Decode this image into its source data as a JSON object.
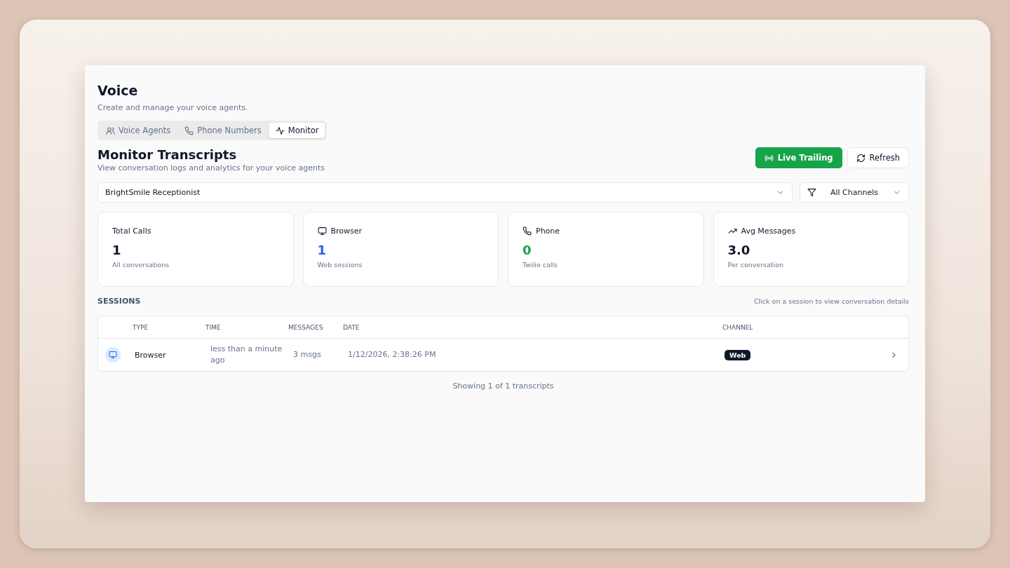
{
  "page": {
    "title": "Voice",
    "subtitle": "Create and manage your voice agents."
  },
  "tabs": [
    {
      "label": "Voice Agents",
      "kind": "agents",
      "selected": false
    },
    {
      "label": "Phone Numbers",
      "kind": "phone",
      "selected": false
    },
    {
      "label": "Monitor",
      "kind": "monitor",
      "selected": true
    }
  ],
  "section": {
    "title": "Monitor Transcripts",
    "subtitle": "View conversation logs and analytics for your voice agents"
  },
  "actions": [
    {
      "label": "Live Trailing",
      "kind": "live"
    },
    {
      "label": "Refresh",
      "kind": "refresh"
    }
  ],
  "filters": {
    "agent": "BrightSmile Receptionist",
    "channel": "All Channels"
  },
  "stats": [
    {
      "kind": "total",
      "label": "Total Calls",
      "value": "1",
      "note": "All conversations",
      "color": "#0f172a"
    },
    {
      "kind": "browser",
      "label": "Browser",
      "value": "1",
      "note": "Web sessions",
      "color": "#2563eb"
    },
    {
      "kind": "phone",
      "label": "Phone",
      "value": "0",
      "note": "Twilio calls",
      "color": "#16a34a"
    },
    {
      "kind": "average",
      "label": "Avg Messages",
      "value": "3.0",
      "note": "Per conversation",
      "color": "#0f172a"
    }
  ],
  "sessions": {
    "heading": "SESSIONS",
    "hint": "Click on a session to view conversation details",
    "columns": [
      "TYPE",
      "TIME",
      "MESSAGES",
      "DATE",
      "CHANNEL"
    ],
    "rows": [
      {
        "kind": "browser",
        "type": "Browser",
        "time": "less than a minute ago",
        "messages": "3 msgs",
        "date": "1/12/2026, 2:38:26 PM",
        "channel": "Web"
      }
    ],
    "footer": "Showing 1 of 1 transcripts"
  }
}
